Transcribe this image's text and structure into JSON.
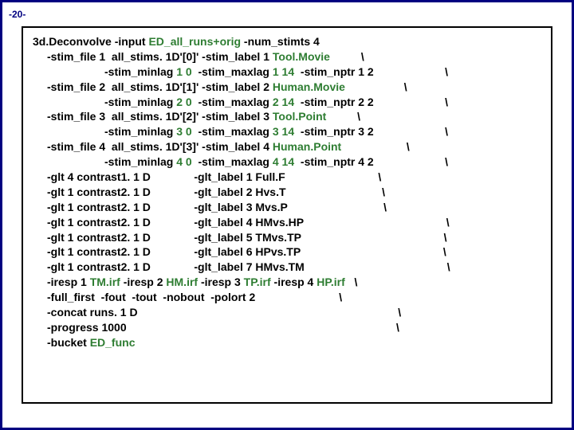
{
  "page_number": "-20-",
  "lines": [
    {
      "cls": "",
      "segs": [
        {
          "t": "3d.Deconvolve -input "
        },
        {
          "t": "ED_all_runs+orig",
          "hl": true
        },
        {
          "t": " -num_stimts 4"
        }
      ]
    },
    {
      "cls": "indent1",
      "segs": [
        {
          "t": "-stim_file 1  all_stims. 1D'[0]' -stim_label 1 "
        },
        {
          "t": "Tool.Movie",
          "hl": true
        },
        {
          "t": "          \\"
        }
      ]
    },
    {
      "cls": "indent2",
      "segs": [
        {
          "t": "-stim_minlag "
        },
        {
          "t": "1 0",
          "hl": true
        },
        {
          "t": "  -stim_maxlag "
        },
        {
          "t": "1 14",
          "hl": true
        },
        {
          "t": "  -stim_nptr 1 2                       \\"
        }
      ]
    },
    {
      "cls": "indent1",
      "segs": [
        {
          "t": "-stim_file 2  all_stims. 1D'[1]' -stim_label 2 "
        },
        {
          "t": "Human.Movie",
          "hl": true
        },
        {
          "t": "                   \\"
        }
      ]
    },
    {
      "cls": "indent2",
      "segs": [
        {
          "t": "-stim_minlag "
        },
        {
          "t": "2 0",
          "hl": true
        },
        {
          "t": "  -stim_maxlag "
        },
        {
          "t": "2 14",
          "hl": true
        },
        {
          "t": "  -stim_nptr 2 2                       \\"
        }
      ]
    },
    {
      "cls": "indent1",
      "segs": [
        {
          "t": "-stim_file 3  all_stims. 1D'[2]' -stim_label 3 "
        },
        {
          "t": "Tool.Point",
          "hl": true
        },
        {
          "t": "          \\"
        }
      ]
    },
    {
      "cls": "indent2",
      "segs": [
        {
          "t": "-stim_minlag "
        },
        {
          "t": "3 0",
          "hl": true
        },
        {
          "t": "  -stim_maxlag "
        },
        {
          "t": "3 14",
          "hl": true
        },
        {
          "t": "  -stim_nptr 3 2                       \\"
        }
      ]
    },
    {
      "cls": "indent1",
      "segs": [
        {
          "t": "-stim_file 4  all_stims. 1D'[3]' -stim_label 4 "
        },
        {
          "t": "Human.Point",
          "hl": true
        },
        {
          "t": "                     \\"
        }
      ]
    },
    {
      "cls": "indent2",
      "segs": [
        {
          "t": "-stim_minlag "
        },
        {
          "t": "4 0",
          "hl": true
        },
        {
          "t": "  -stim_maxlag "
        },
        {
          "t": "4 14",
          "hl": true
        },
        {
          "t": "  -stim_nptr 4 2                       \\"
        }
      ]
    },
    {
      "cls": "indent1",
      "segs": [
        {
          "t": "-glt 4 contrast1. 1 D              -glt_label 1 Full.F                              \\"
        }
      ]
    },
    {
      "cls": "indent1",
      "segs": [
        {
          "t": "-glt 1 contrast2. 1 D              -glt_label 2 Hvs.T                               \\"
        }
      ]
    },
    {
      "cls": "indent1",
      "segs": [
        {
          "t": "-glt 1 contrast2. 1 D              -glt_label 3 Mvs.P                               \\"
        }
      ]
    },
    {
      "cls": "indent1",
      "segs": [
        {
          "t": "-glt 1 contrast2. 1 D              -glt_label 4 HMvs.HP                                              \\"
        }
      ]
    },
    {
      "cls": "indent1",
      "segs": [
        {
          "t": "-glt 1 contrast2. 1 D              -glt_label 5 TMvs.TP                                              \\"
        }
      ]
    },
    {
      "cls": "indent1",
      "segs": [
        {
          "t": "-glt 1 contrast2. 1 D              -glt_label 6 HPvs.TP                                              \\"
        }
      ]
    },
    {
      "cls": "indent1",
      "segs": [
        {
          "t": "-glt 1 contrast2. 1 D              -glt_label 7 HMvs.TM                                              \\"
        }
      ]
    },
    {
      "cls": "indent1",
      "segs": [
        {
          "t": "-iresp 1 "
        },
        {
          "t": "TM.irf",
          "hl": true
        },
        {
          "t": " -iresp 2 "
        },
        {
          "t": "HM.irf",
          "hl": true
        },
        {
          "t": " -iresp 3 "
        },
        {
          "t": "TP.irf",
          "hl": true
        },
        {
          "t": " -iresp 4 "
        },
        {
          "t": "HP.irf",
          "hl": true
        },
        {
          "t": "   \\"
        }
      ]
    },
    {
      "cls": "indent1",
      "segs": [
        {
          "t": "-full_first  -fout  -tout  -nobout  -polort 2                           \\"
        }
      ]
    },
    {
      "cls": "indent1",
      "segs": [
        {
          "t": "-concat runs. 1 D                                                                                    \\"
        }
      ]
    },
    {
      "cls": "indent1",
      "segs": [
        {
          "t": "-progress 1000                                                                                       \\"
        }
      ]
    },
    {
      "cls": "indent1",
      "segs": [
        {
          "t": "-bucket "
        },
        {
          "t": "ED_func",
          "hl": true
        }
      ]
    }
  ]
}
